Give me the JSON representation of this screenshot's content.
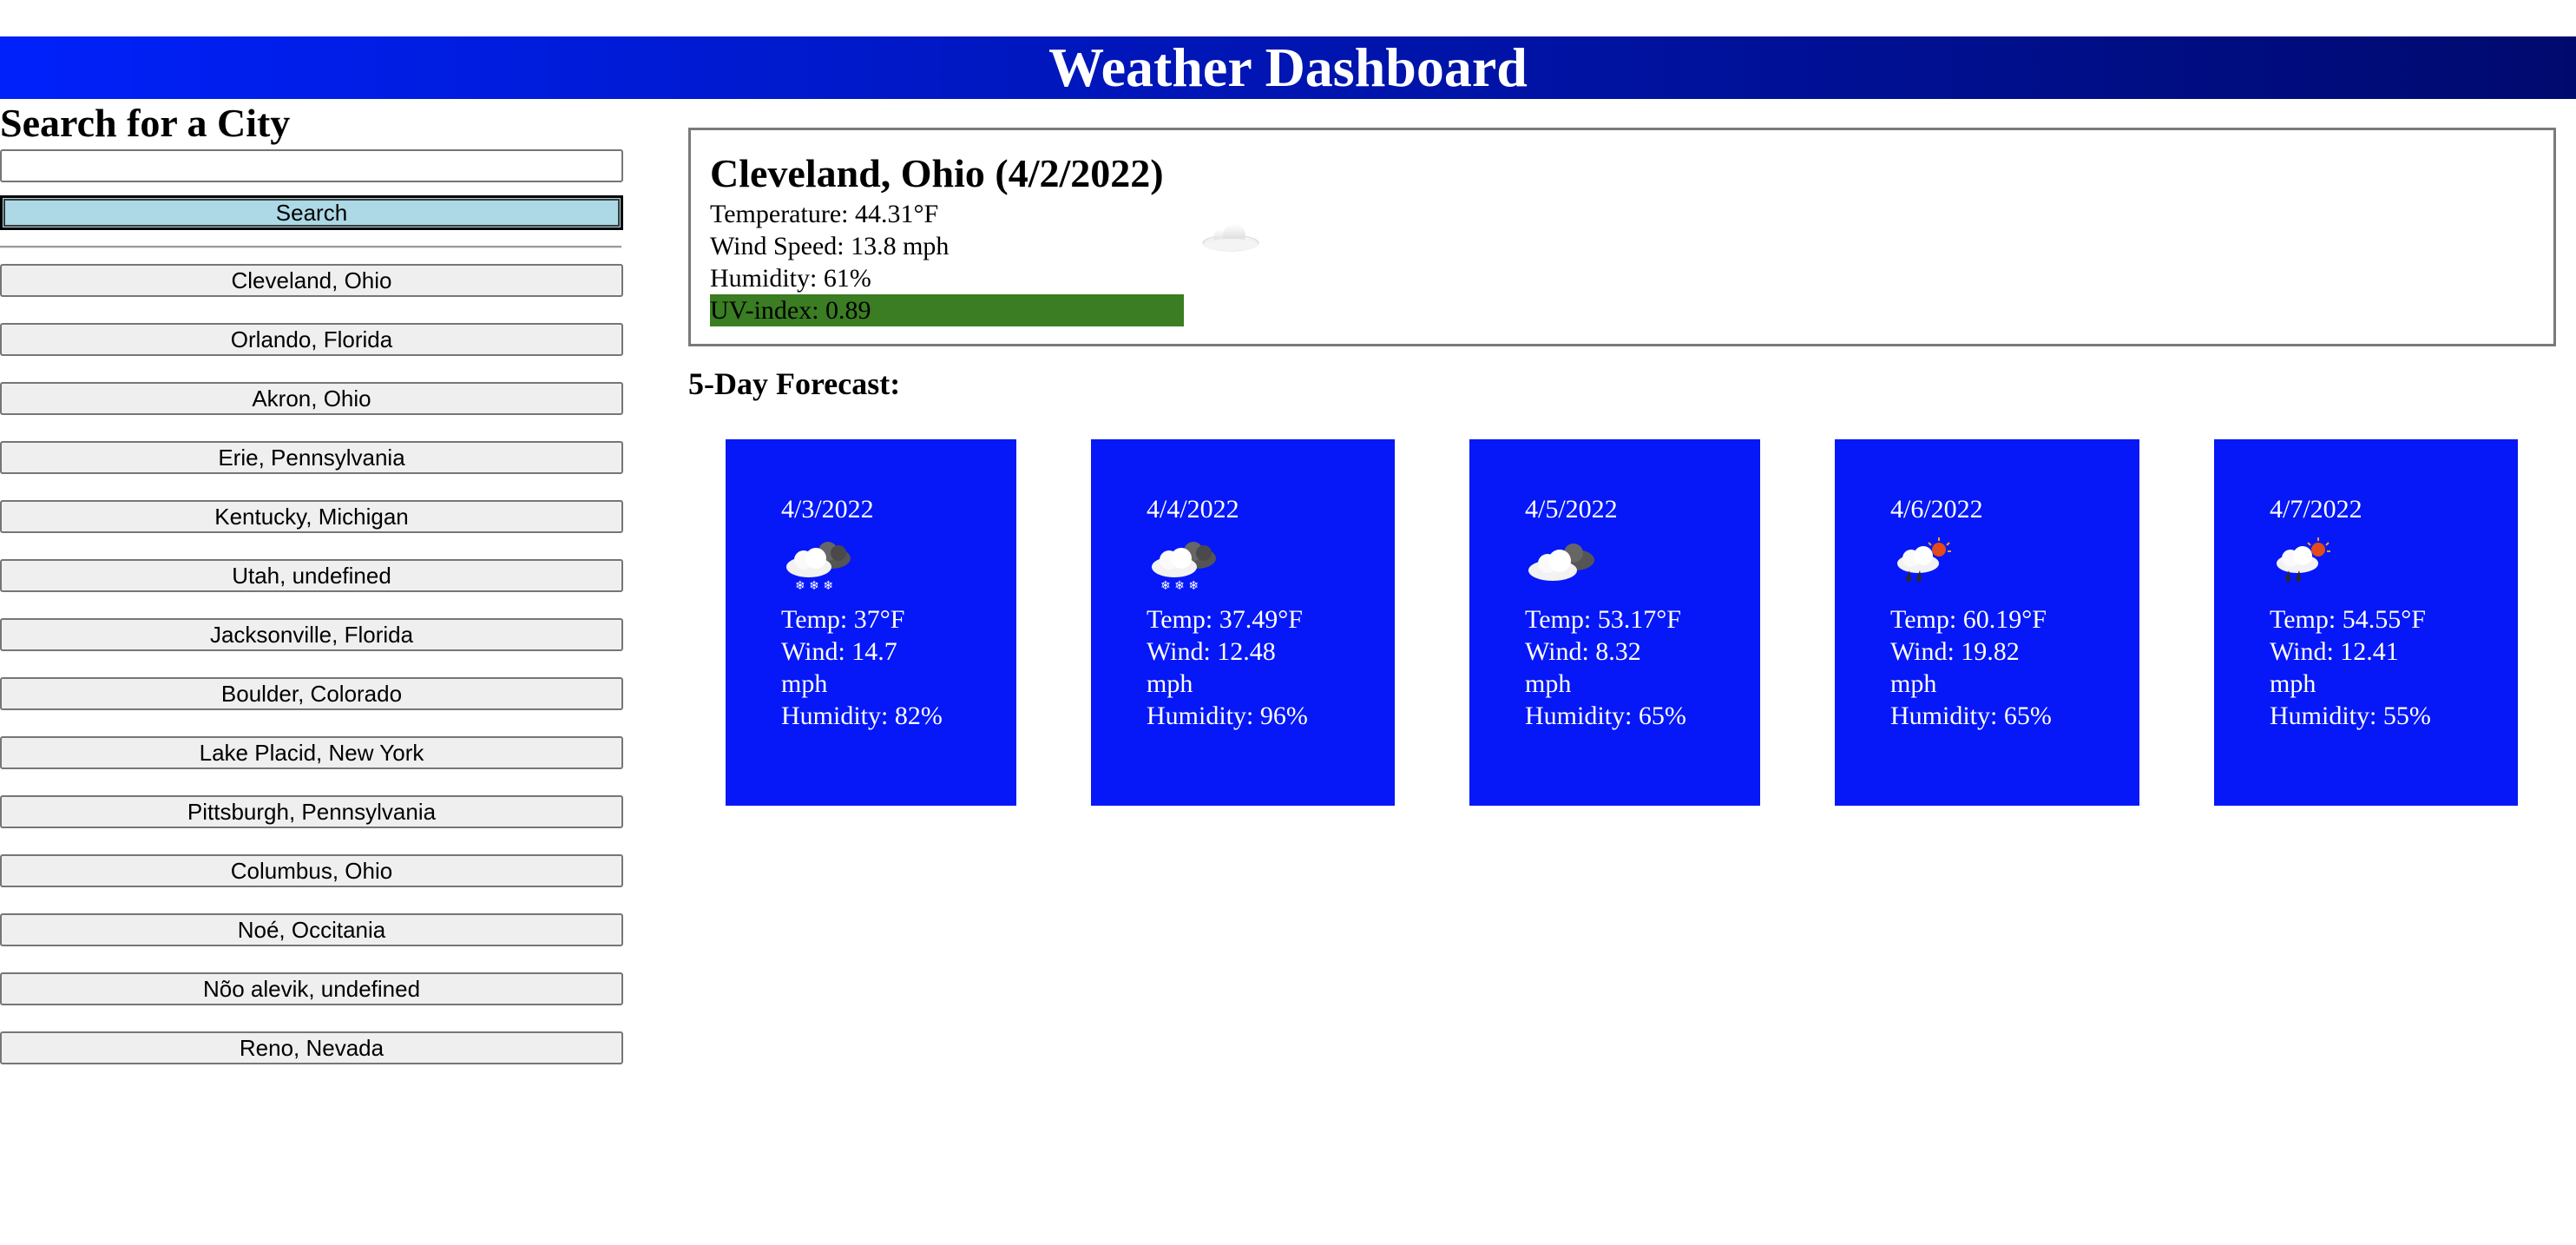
{
  "header": {
    "title": "Weather Dashboard"
  },
  "sidebar": {
    "heading": "Search for a City",
    "input_value": "",
    "search_label": "Search",
    "history": [
      "Cleveland, Ohio",
      "Orlando, Florida",
      "Akron, Ohio",
      "Erie, Pennsylvania",
      "Kentucky, Michigan",
      "Utah, undefined",
      "Jacksonville, Florida",
      "Boulder, Colorado",
      "Lake Placid, New York",
      "Pittsburgh, Pennsylvania",
      "Columbus, Ohio",
      "Noé, Occitania",
      "Nõo alevik, undefined",
      "Reno, Nevada"
    ]
  },
  "current": {
    "title": "Cleveland, Ohio (4/2/2022)",
    "temperature": "Temperature: 44.31°F",
    "wind": "Wind Speed: 13.8 mph",
    "humidity": "Humidity: 61%",
    "uv": "UV-index: 0.89",
    "uv_color": "#3a7d22",
    "icon": "cloud-icon"
  },
  "forecast": {
    "title": "5-Day Forecast:",
    "card_color": "#0618f7",
    "days": [
      {
        "date": "4/3/2022",
        "icon": "snow-cloud-icon",
        "temp": "Temp: 37°F",
        "wind": "Wind: 14.7 mph",
        "humidity": "Humidity: 82%"
      },
      {
        "date": "4/4/2022",
        "icon": "snow-cloud-icon",
        "temp": "Temp: 37.49°F",
        "wind": "Wind: 12.48 mph",
        "humidity": "Humidity: 96%"
      },
      {
        "date": "4/5/2022",
        "icon": "cloud-icon",
        "temp": "Temp: 53.17°F",
        "wind": "Wind: 8.32 mph",
        "humidity": "Humidity: 65%"
      },
      {
        "date": "4/6/2022",
        "icon": "rain-sun-icon",
        "temp": "Temp: 60.19°F",
        "wind": "Wind: 19.82 mph",
        "humidity": "Humidity: 65%"
      },
      {
        "date": "4/7/2022",
        "icon": "rain-sun-icon",
        "temp": "Temp: 54.55°F",
        "wind": "Wind: 12.41 mph",
        "humidity": "Humidity: 55%"
      }
    ]
  }
}
